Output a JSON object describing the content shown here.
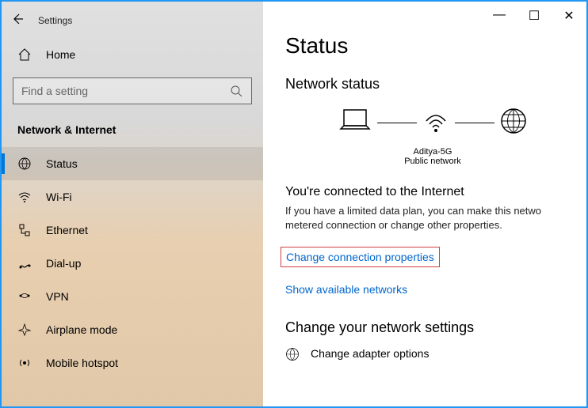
{
  "window": {
    "title": "Settings"
  },
  "sidebar": {
    "home": "Home",
    "search_placeholder": "Find a setting",
    "category": "Network & Internet",
    "items": [
      {
        "label": "Status"
      },
      {
        "label": "Wi-Fi"
      },
      {
        "label": "Ethernet"
      },
      {
        "label": "Dial-up"
      },
      {
        "label": "VPN"
      },
      {
        "label": "Airplane mode"
      },
      {
        "label": "Mobile hotspot"
      }
    ]
  },
  "main": {
    "page_title": "Status",
    "network_status_title": "Network status",
    "network_name": "Aditya-5G",
    "network_type": "Public network",
    "connected_title": "You're connected to the Internet",
    "connected_text": "If you have a limited data plan, you can make this netwo metered connection or change other properties.",
    "link_change_props": "Change connection properties",
    "link_show_networks": "Show available networks",
    "change_settings_title": "Change your network settings",
    "adapter_title": "Change adapter options"
  }
}
